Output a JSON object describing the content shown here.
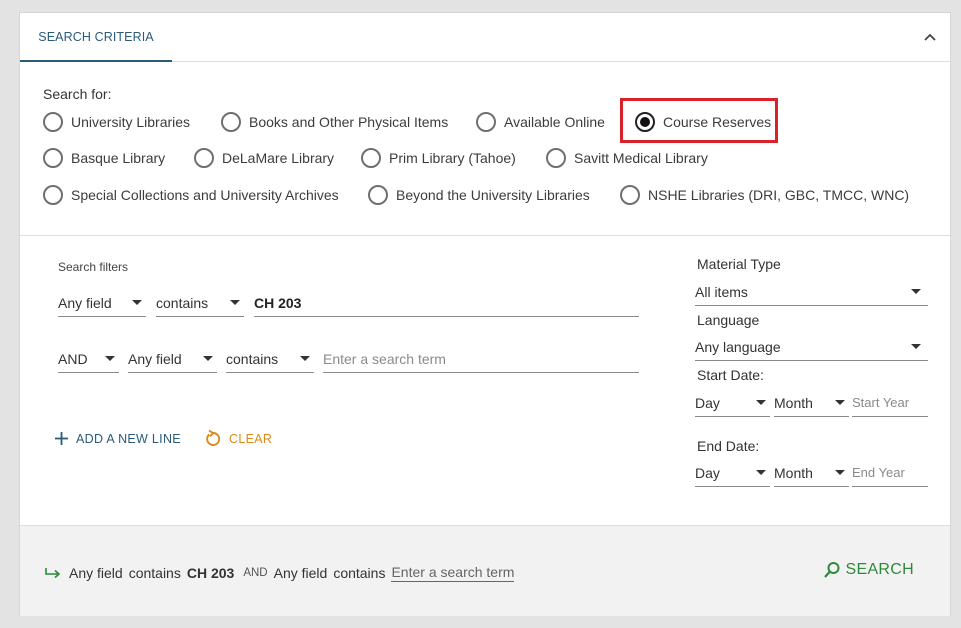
{
  "header": {
    "tab_label": "SEARCH CRITERIA"
  },
  "search_for": {
    "label": "Search for:",
    "options": [
      "University Libraries",
      "Books and Other Physical Items",
      "Available Online",
      "Course Reserves",
      "Basque Library",
      "DeLaMare Library",
      "Prim Library (Tahoe)",
      "Savitt Medical Library",
      "Special Collections and University Archives",
      "Beyond the University Libraries",
      "NSHE Libraries (DRI, GBC, TMCC, WNC)"
    ],
    "selected": "Course Reserves"
  },
  "filters": {
    "label": "Search filters",
    "row1": {
      "field": "Any field",
      "operator": "contains",
      "value": "CH 203"
    },
    "row2": {
      "boolean": "AND",
      "field": "Any field",
      "operator": "contains",
      "placeholder": "Enter a search term"
    },
    "add_line_label": "ADD A NEW LINE",
    "clear_label": "CLEAR"
  },
  "refine": {
    "material_type_label": "Material Type",
    "material_type_value": "All items",
    "language_label": "Language",
    "language_value": "Any language",
    "start_date_label": "Start Date:",
    "end_date_label": "End Date:",
    "day_label": "Day",
    "month_label": "Month",
    "start_year_placeholder": "Start Year",
    "end_year_placeholder": "End Year"
  },
  "summary": {
    "field1": "Any field",
    "op1": "contains",
    "value1": "CH 203",
    "boolean": "AND",
    "field2": "Any field",
    "op2": "contains",
    "term2": "Enter a search term"
  },
  "search_button_label": "SEARCH",
  "colors": {
    "accent": "#2b5a7a",
    "highlight": "#d9222a",
    "search": "#2d8a3a",
    "clear": "#d98a1a"
  }
}
